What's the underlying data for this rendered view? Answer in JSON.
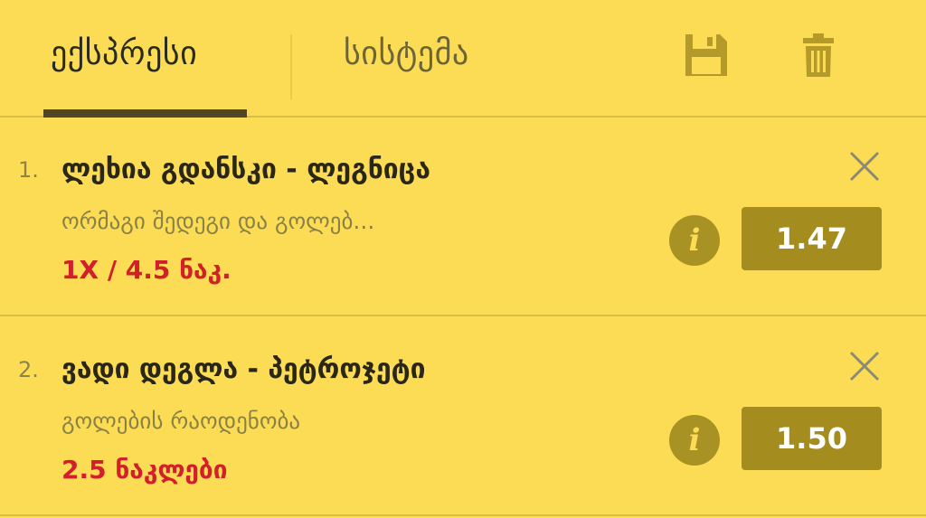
{
  "tabs": {
    "express_label": "ექსპრესი",
    "system_label": "სისტემა",
    "active": "express"
  },
  "toolbar": {
    "save_icon": "floppy-disk-icon",
    "trash_icon": "trash-icon"
  },
  "bets": [
    {
      "index": "1.",
      "title": "ლეხია გდანსკი - ლეგნიცა",
      "market": "ორმაგი შედეგი და გოლებ...",
      "selection": "1X / 4.5 ნაკ.",
      "odds": "1.47"
    },
    {
      "index": "2.",
      "title": "ვადი დეგლა - პეტროჯეტი",
      "market": "გოლების რაოდენობა",
      "selection": "2.5 ნაკლები",
      "odds": "1.50"
    }
  ],
  "colors": {
    "background": "#FCDC54",
    "accent_dark": "#4E4624",
    "odds_button": "#A48C1E",
    "selection_text": "#D1202A",
    "icon": "#B49A28"
  }
}
